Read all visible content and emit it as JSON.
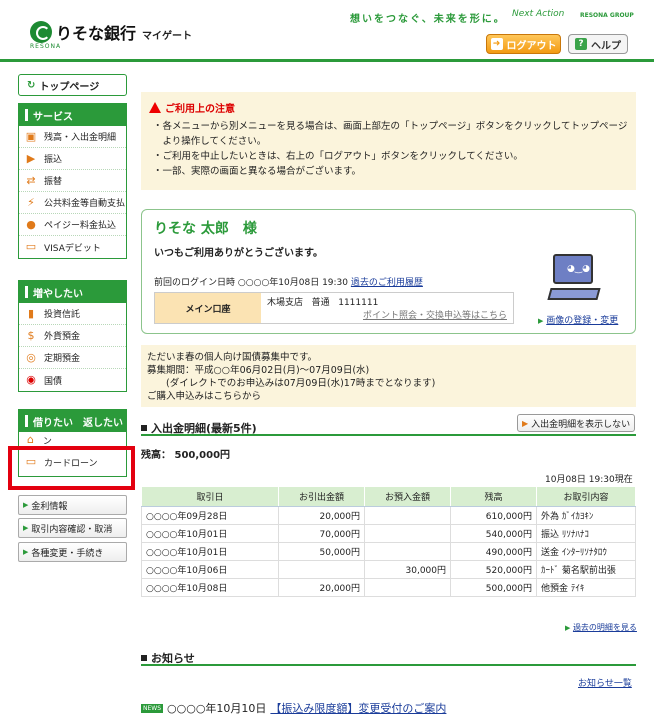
{
  "header": {
    "bank_name": "りそな銀行",
    "app_name": "マイゲート",
    "logo_sub": "RESONA",
    "slogan": "想いをつなぐ、未来を形に。",
    "slogan_brand": "Next Action",
    "group": "RESONA GROUP",
    "logout_label": "ログアウト",
    "help_label": "ヘルプ"
  },
  "sidebar": {
    "top_page": "トップページ",
    "service": {
      "title": "サービス",
      "items": [
        {
          "label": "残高・入出金明細",
          "icon": "wallet-icon"
        },
        {
          "label": "振込",
          "icon": "transfer-icon"
        },
        {
          "label": "振替",
          "icon": "exchange-icon"
        },
        {
          "label": "公共料金等自動支払",
          "icon": "utility-icon"
        },
        {
          "label": "ペイジー料金払込",
          "icon": "payeasy-icon"
        },
        {
          "label": "VISAデビット",
          "icon": "debit-card-icon"
        }
      ]
    },
    "grow": {
      "title": "増やしたい",
      "items": [
        {
          "label": "投資信託",
          "icon": "chart-icon"
        },
        {
          "label": "外貨預金",
          "icon": "dollar-icon"
        },
        {
          "label": "定期預金",
          "icon": "coin-icon"
        },
        {
          "label": "国債",
          "icon": "flag-icon"
        }
      ]
    },
    "borrow": {
      "title": "借りたい　返したい",
      "items": [
        {
          "label": "住宅・その他の日ーン",
          "icon": "house-icon"
        },
        {
          "label": "カードローン",
          "icon": "card-icon"
        }
      ]
    },
    "links": [
      "金利情報",
      "取引内容確認・取消",
      "各種変更・手続き"
    ]
  },
  "notice": {
    "title": "ご利用上の注意",
    "lines": [
      "・各メニューから別メニューを見る場合は、画面上部左の「トップページ」ボタンをクリックしてトップページ",
      "　より操作してください。",
      "・ご利用を中止したいときは、右上の「ログアウト」ボタンをクリックしてください。",
      "・一部、実際の画面と異なる場合がございます。"
    ]
  },
  "welcome": {
    "name": "りそな 太郎　様",
    "message": "いつもご利用ありがとうございます。",
    "last_login_label": "前回のログイン日時",
    "last_login_value": "○○○○年10月08日 19:30",
    "history_link": "過去のご利用履歴",
    "account_label": "メイン口座",
    "branch": "木場支店",
    "account_type": "普通",
    "account_number": "1111111",
    "points_link": "ポイント照会・交換申込等はこちら",
    "image_link": "画像の登録・変更"
  },
  "campaign": {
    "lines": [
      "ただいま春の個人向け国債募集中です。",
      "募集期間：平成○○年06月02日(月)～07月09日(水)",
      "　　(ダイレクトでのお申込みは07月09日(水)17時までとなります)",
      "ご購入申込みはこちらから"
    ]
  },
  "transactions": {
    "title": "入出金明細(最新5件)",
    "hide_button": "入出金明細を表示しない",
    "balance": "残高： 500,000円",
    "as_of": "10月08日 19:30現在",
    "headers": [
      "取引日",
      "お引出金額",
      "お預入金額",
      "残高",
      "お取引内容"
    ],
    "rows": [
      [
        "○○○○年09月28日",
        "20,000円",
        "",
        "610,000円",
        "外為 ｶﾞｲｶﾖｷﾝ"
      ],
      [
        "○○○○年10月01日",
        "70,000円",
        "",
        "540,000円",
        "振込 ﾘｿﾅﾊﾅｺ"
      ],
      [
        "○○○○年10月01日",
        "50,000円",
        "",
        "490,000円",
        "送金 ｲﾝﾀｰﾘｿﾅﾀﾛｳ"
      ],
      [
        "○○○○年10月06日",
        "",
        "30,000円",
        "520,000円",
        "ｶｰﾄﾞ 菊名駅前出張"
      ],
      [
        "○○○○年10月08日",
        "20,000円",
        "",
        "500,000円",
        "他預金 ﾃｲｷ"
      ]
    ],
    "past_link": "過去の明細を見る"
  },
  "news": {
    "title": "お知らせ",
    "all_link": "お知らせ一覧",
    "badge": "NEWS",
    "date": "○○○○年10月10日",
    "link": "【振込み限度額】変更受付のご案内"
  },
  "colors": {
    "brand_green": "#2b9a3a",
    "logout_orange": "#f39a12",
    "highlight_red": "#e3000f"
  }
}
